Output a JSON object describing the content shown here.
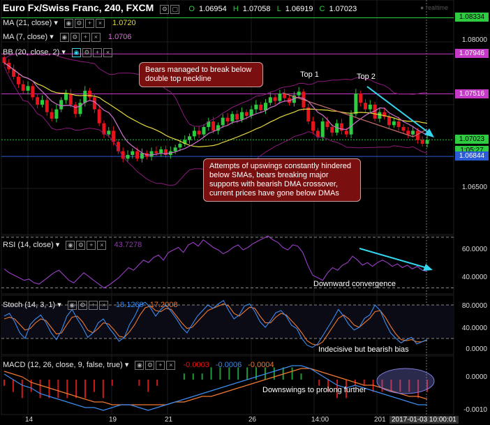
{
  "header": {
    "title": "Euro Fx/Swiss Franc, 240, FXCM",
    "ohlc": [
      {
        "k": "O",
        "v": "1.06954"
      },
      {
        "k": "H",
        "v": "1.07058"
      },
      {
        "k": "L",
        "v": "1.06919"
      },
      {
        "k": "C",
        "v": "1.07023"
      }
    ],
    "realtime": "realtime"
  },
  "indicators": {
    "ma21": {
      "label": "MA (21, close)",
      "value": "1.0720"
    },
    "ma7": {
      "label": "MA (7, close)",
      "value": "1.0706"
    },
    "bb": {
      "label": "BB (20, close, 2)"
    }
  },
  "colors": {
    "up": "#2ecc40",
    "down": "#e8141c",
    "ma21": "#e6d83c",
    "ma7": "#d070d0",
    "bb": "#8b1a7c",
    "cyan": "#34d6f0",
    "hline_blue": "#2a5cd8",
    "hline_mag": "#c639c6",
    "rsi": "#9a3fc8",
    "stoch_k": "#3b8df0",
    "stoch_d": "#f07a30",
    "macd": "#3b8df0",
    "signal": "#f07a30"
  },
  "price_panel": {
    "ylim": [
      1.0605,
      1.0845
    ],
    "axis_labels": [
      "1.08000",
      "1.06500"
    ],
    "price_tags": [
      {
        "text": "1.08334",
        "value": 1.08334,
        "bg": "#2ecc40",
        "fg": "#000"
      },
      {
        "text": "1.07946",
        "value": 1.07946,
        "bg": "#c639c6",
        "fg": "#fff"
      },
      {
        "text": "1.07516",
        "value": 1.07516,
        "bg": "#c639c6",
        "fg": "#fff"
      },
      {
        "text": "1.07023",
        "value": 1.07023,
        "bg": "#2ecc40",
        "fg": "#000"
      },
      {
        "text": "1:05:27",
        "value": 1.06905,
        "bg": "#2ecc40",
        "fg": "#000"
      },
      {
        "text": "1.06844",
        "value": 1.06844,
        "bg": "#2a5cd8",
        "fg": "#fff"
      }
    ],
    "annotations": {
      "callout_top": "Bears managed to break below double top neckline",
      "callout_bottom": "Attempts of upswings constantly hindered below SMAs, bears breaking major supports with bearish DMA crossover, current prices have gone below DMAs",
      "top1": "Top 1",
      "top2": "Top 2"
    }
  },
  "chart_data": {
    "type": "candlestick",
    "instrument": "Euro Fx/Swiss Franc",
    "timeframe": "240",
    "x_labels": [
      "14",
      "19",
      "21",
      "26",
      "14:00",
      "201",
      "2017-01-03 10:00:01"
    ],
    "closes": [
      1.0785,
      1.0778,
      1.077,
      1.0762,
      1.0755,
      1.076,
      1.0748,
      1.074,
      1.0745,
      1.0732,
      1.0725,
      1.0735,
      1.0745,
      1.0752,
      1.074,
      1.073,
      1.0742,
      1.0755,
      1.0748,
      1.0735,
      1.072,
      1.0708,
      1.0712,
      1.07,
      1.069,
      1.0682,
      1.0686,
      1.069,
      1.0682,
      1.0688,
      1.0684,
      1.069,
      1.0688,
      1.0692,
      1.0686,
      1.069,
      1.0694,
      1.0698,
      1.0702,
      1.0706,
      1.0712,
      1.0708,
      1.0716,
      1.0722,
      1.0712,
      1.0718,
      1.0726,
      1.0722,
      1.073,
      1.0724,
      1.0732,
      1.0728,
      1.0735,
      1.074,
      1.0734,
      1.0742,
      1.0748,
      1.0744,
      1.0752,
      1.0747,
      1.0742,
      1.075,
      1.0754,
      1.0737,
      1.0722,
      1.0712,
      1.0705,
      1.0722,
      1.0716,
      1.071,
      1.072,
      1.0712,
      1.0708,
      1.073,
      1.0752,
      1.0742,
      1.0735,
      1.074,
      1.0725,
      1.0732,
      1.0727,
      1.0718,
      1.0722,
      1.0716,
      1.0712,
      1.0708,
      1.0712,
      1.0702,
      1.0698,
      1.0702
    ],
    "ma21": {
      "label": "MA (21, close)",
      "value": 1.072
    },
    "ma7": {
      "label": "MA (7, close)",
      "value": 1.0706
    },
    "bollinger": {
      "label": "BB (20, close, 2)"
    },
    "horizontal_levels": [
      1.08334,
      1.07946,
      1.07516,
      1.07023,
      1.06844
    ],
    "rsi": {
      "label": "RSI (14, close)",
      "value": "43.7278",
      "ylim": [
        27,
        70
      ],
      "axis_labels": [
        "60.0000",
        "40.0000"
      ],
      "bands": [
        70,
        30
      ],
      "values": [
        45,
        42,
        40,
        38,
        36,
        37,
        34,
        33,
        36,
        39,
        42,
        44,
        40,
        36,
        34,
        38,
        42,
        39,
        36,
        33,
        30,
        32,
        35,
        38,
        42,
        46,
        44,
        48,
        52,
        50,
        54,
        56,
        52,
        58,
        60,
        62,
        58,
        64,
        66,
        63,
        68,
        65,
        62,
        60,
        57,
        59,
        62,
        64,
        60,
        62,
        65,
        67,
        69,
        71,
        68,
        66,
        62,
        60,
        64,
        63,
        58,
        48,
        40,
        38,
        36,
        42,
        46,
        44,
        48,
        50,
        55,
        52,
        48,
        50,
        47,
        50,
        52,
        50,
        47,
        49,
        46,
        48,
        45,
        47,
        44,
        43
      ]
    },
    "stoch": {
      "label": "Stoch (14, 3, 1)",
      "k_value": "18.1269",
      "d_value": "17.2008",
      "ylim": [
        -5,
        95
      ],
      "axis_labels": [
        "80.0000",
        "40.0000",
        "0.0000"
      ],
      "k": [
        60,
        65,
        50,
        30,
        20,
        45,
        55,
        62,
        48,
        30,
        18,
        35,
        60,
        72,
        55,
        40,
        22,
        30,
        48,
        55,
        40,
        28,
        15,
        22,
        45,
        60,
        80,
        85,
        75,
        60,
        72,
        80,
        68,
        55,
        40,
        30,
        45,
        60,
        70,
        80,
        74,
        82,
        88,
        70,
        55,
        62,
        78,
        82,
        68,
        50,
        40,
        52,
        66,
        70,
        60,
        44,
        38,
        20,
        8,
        4,
        10,
        25,
        40,
        55,
        72,
        60,
        45,
        35,
        40,
        56,
        62,
        80,
        70,
        48,
        30,
        20,
        12,
        18,
        22,
        10,
        14,
        18
      ],
      "d": [
        55,
        58,
        55,
        45,
        35,
        38,
        48,
        55,
        52,
        40,
        28,
        30,
        45,
        58,
        60,
        50,
        35,
        30,
        38,
        48,
        46,
        36,
        24,
        22,
        32,
        45,
        62,
        75,
        78,
        70,
        68,
        74,
        72,
        60,
        48,
        38,
        40,
        50,
        60,
        70,
        74,
        78,
        82,
        78,
        65,
        60,
        68,
        76,
        74,
        60,
        48,
        48,
        58,
        65,
        62,
        52,
        42,
        30,
        16,
        10,
        8,
        14,
        28,
        42,
        56,
        62,
        55,
        44,
        40,
        48,
        56,
        68,
        70,
        58,
        42,
        28,
        18,
        16,
        18,
        14,
        14,
        17
      ]
    },
    "macd": {
      "label": "MACD (12, 26, close, 9, false, true)",
      "values_text": [
        "-0.0003",
        "-0.0006",
        "-0.0004"
      ],
      "ylim": [
        -0.0012,
        0.0008
      ],
      "axis_labels": [
        "0.0000",
        "-0.0010"
      ],
      "macd": [
        0.0002,
        0.0,
        -0.0002,
        -0.0003,
        -0.0005,
        -0.0006,
        -0.0007,
        -0.0008,
        -0.0009,
        -0.001,
        -0.001,
        -0.0011,
        -0.001,
        -0.0009,
        -0.0009,
        -0.001,
        -0.0011,
        -0.001,
        -0.0009,
        -0.0008,
        -0.0007,
        -0.0006,
        -0.0005,
        -0.0004,
        -0.0003,
        -0.0002,
        -0.0001,
        0.0,
        0.0001,
        0.0002,
        0.0003,
        0.0004,
        0.0005,
        0.0005,
        0.0004,
        0.0002,
        0.0,
        -0.0002,
        -0.0003,
        -0.0002,
        -0.0003,
        -0.0004,
        -0.0005,
        -0.0006,
        -0.0007,
        -0.0008,
        -0.0009,
        -0.0009
      ],
      "signal": [
        0.0003,
        0.0002,
        0.0001,
        -0.0001,
        -0.0002,
        -0.0003,
        -0.0004,
        -0.0005,
        -0.0006,
        -0.0007,
        -0.0008,
        -0.0008,
        -0.0009,
        -0.0009,
        -0.0009,
        -0.0009,
        -0.0009,
        -0.0009,
        -0.0009,
        -0.0008,
        -0.0008,
        -0.0007,
        -0.0006,
        -0.0006,
        -0.0005,
        -0.0004,
        -0.0003,
        -0.0002,
        -0.0001,
        0.0,
        0.0001,
        0.0002,
        0.0003,
        0.0004,
        0.0004,
        0.0003,
        0.0002,
        0.0001,
        0.0,
        -0.0001,
        -0.0002,
        -0.0002,
        -0.0003,
        -0.0004,
        -0.0005,
        -0.0006,
        -0.0006,
        -0.0007
      ]
    }
  },
  "panel_notes": {
    "rsi": "Downward convergence",
    "stoch": "Indecisive but bearish bias",
    "macd": "Downswings to prolong further"
  }
}
